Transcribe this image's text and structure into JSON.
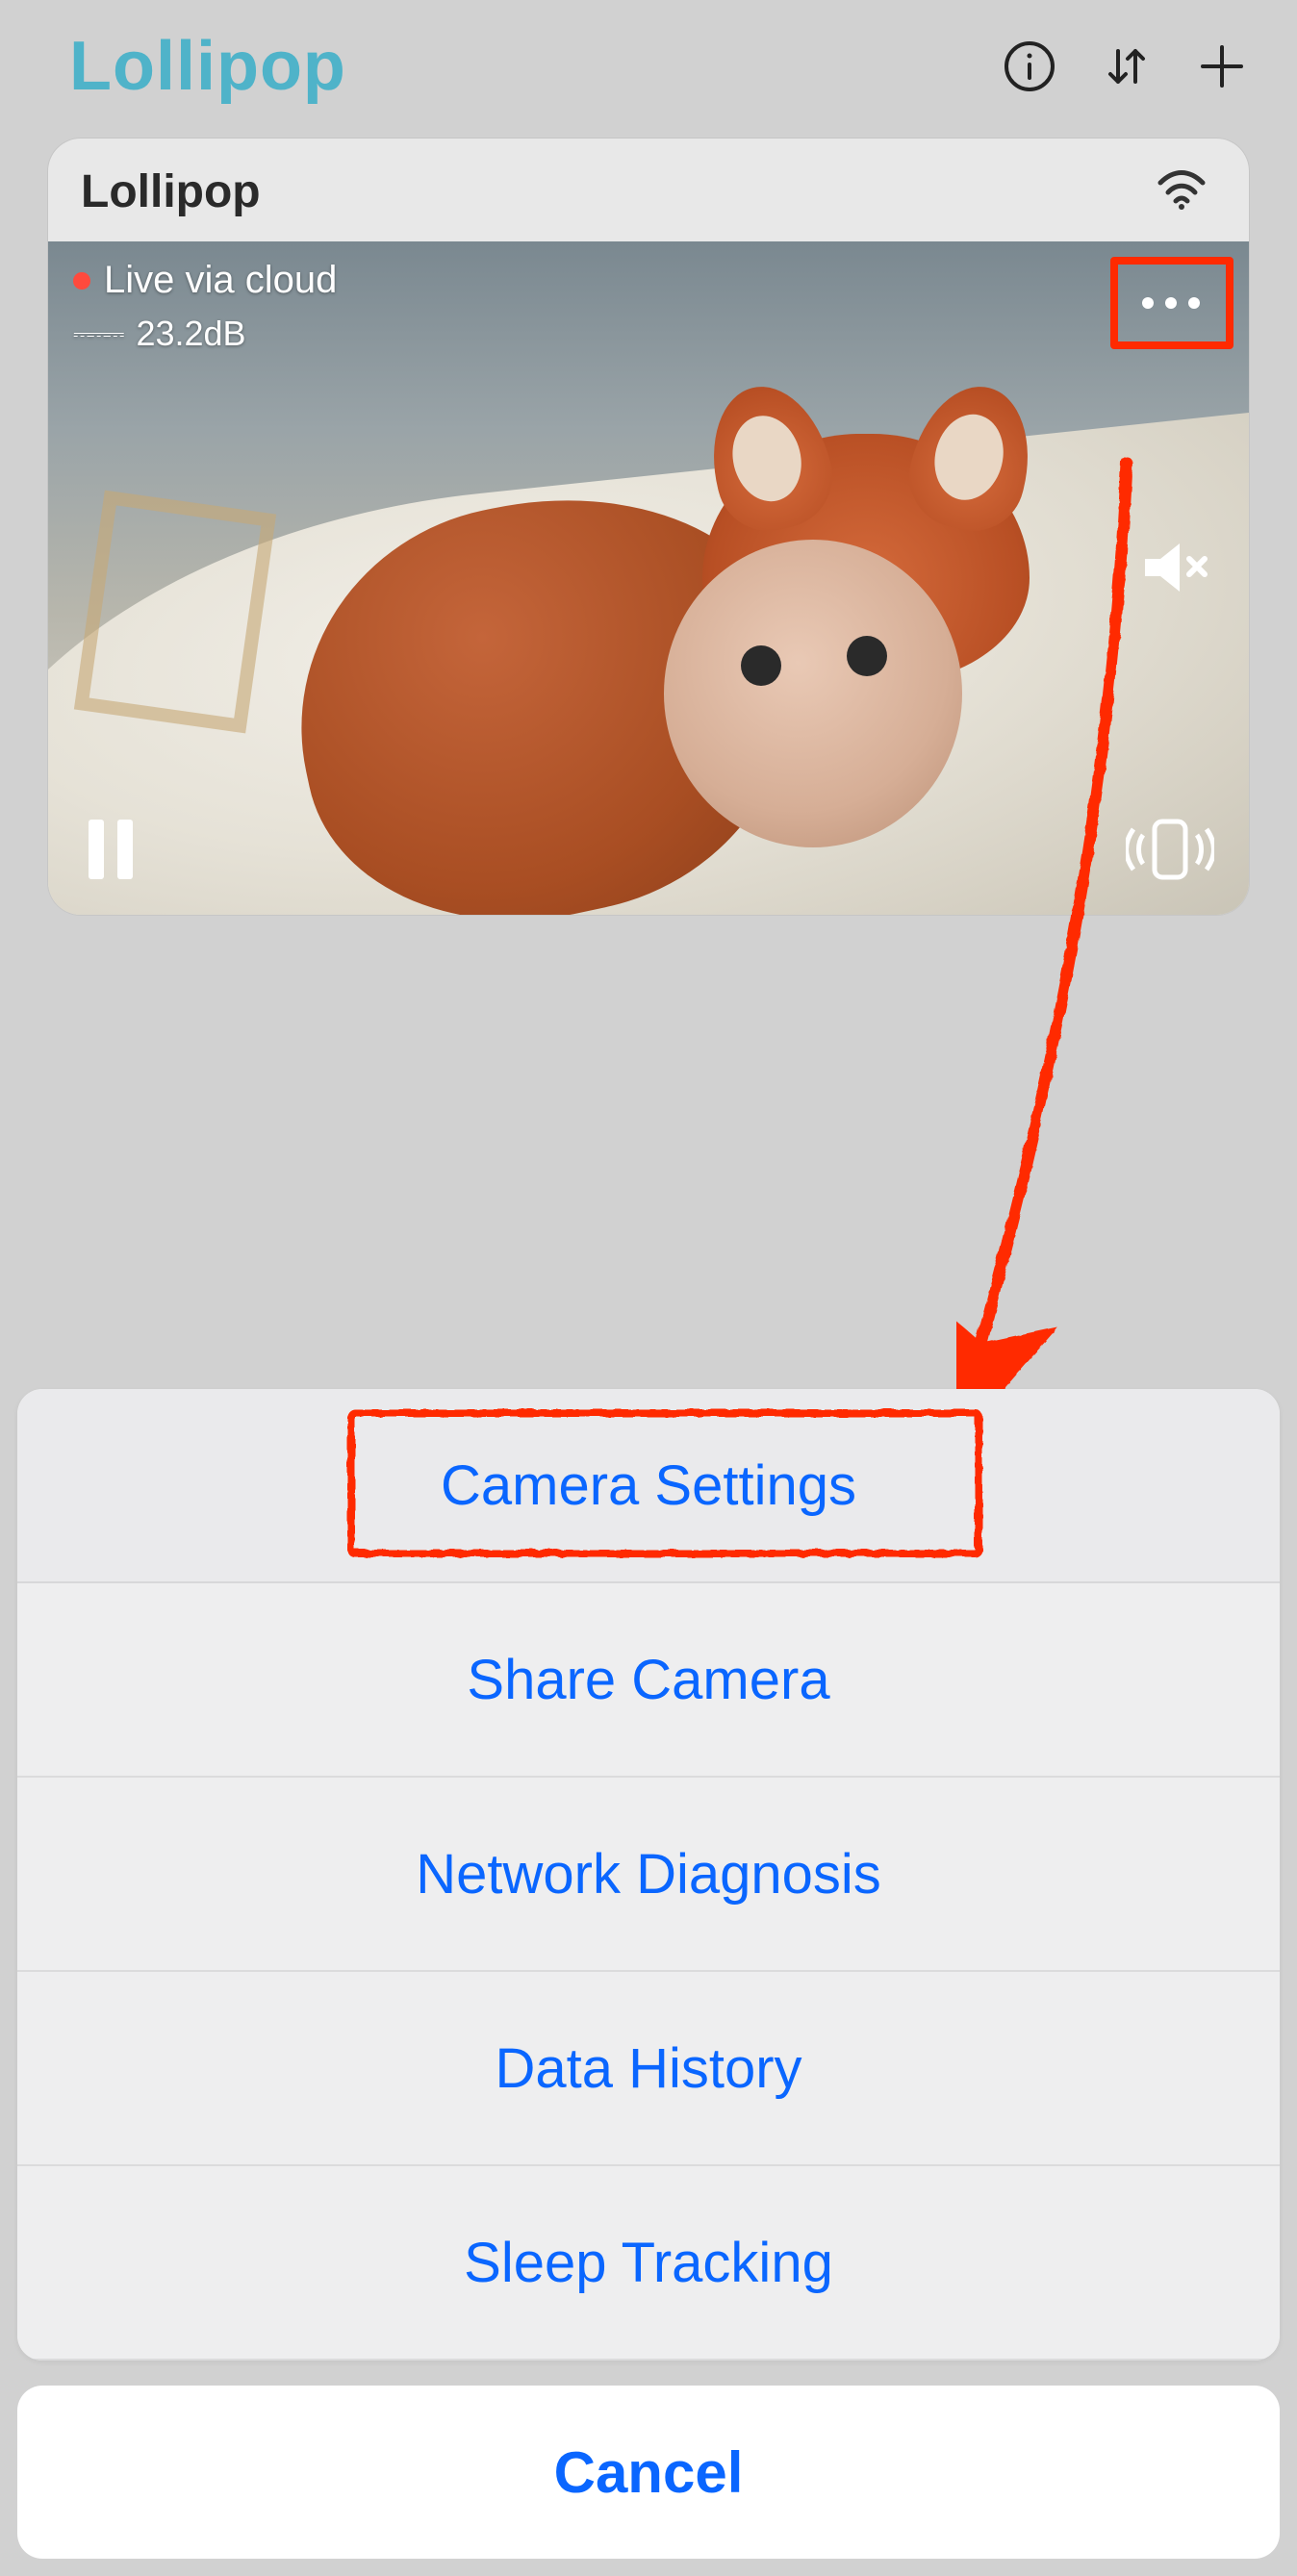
{
  "header": {
    "brand": "Lollipop",
    "icons": {
      "info": "info-icon",
      "sort": "sort-arrows-icon",
      "add": "plus-icon"
    }
  },
  "camera": {
    "name": "Lollipop",
    "live_status": "Live via cloud",
    "db_value": "23.2dB",
    "icons": {
      "wifi": "wifi-icon",
      "more": "more-icon",
      "mute": "mute-icon",
      "pause": "pause-icon",
      "vibrate": "phone-vibrate-icon"
    }
  },
  "sheet": {
    "items": [
      "Camera Settings",
      "Share Camera",
      "Network Diagnosis",
      "Data History",
      "Sleep Tracking"
    ],
    "cancel": "Cancel"
  },
  "colors": {
    "brand": "#4fb3c9",
    "link": "#0a66ff",
    "highlight": "#ff2a00"
  }
}
